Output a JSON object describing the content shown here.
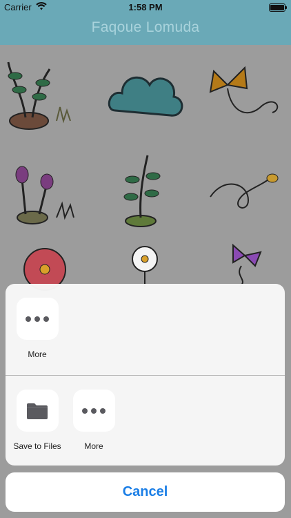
{
  "status_bar": {
    "carrier": "Carrier",
    "time": "1:58 PM"
  },
  "nav": {
    "title": "Faqoue Lomuda"
  },
  "share_sheet": {
    "app_row": [
      {
        "label": "More",
        "icon": "more-icon"
      }
    ],
    "action_row": [
      {
        "label": "Save to Files",
        "icon": "folder-icon"
      },
      {
        "label": "More",
        "icon": "more-icon"
      }
    ],
    "cancel_label": "Cancel"
  },
  "colors": {
    "nav_bg": "#6aa9b7",
    "accent": "#1a7ee6"
  }
}
